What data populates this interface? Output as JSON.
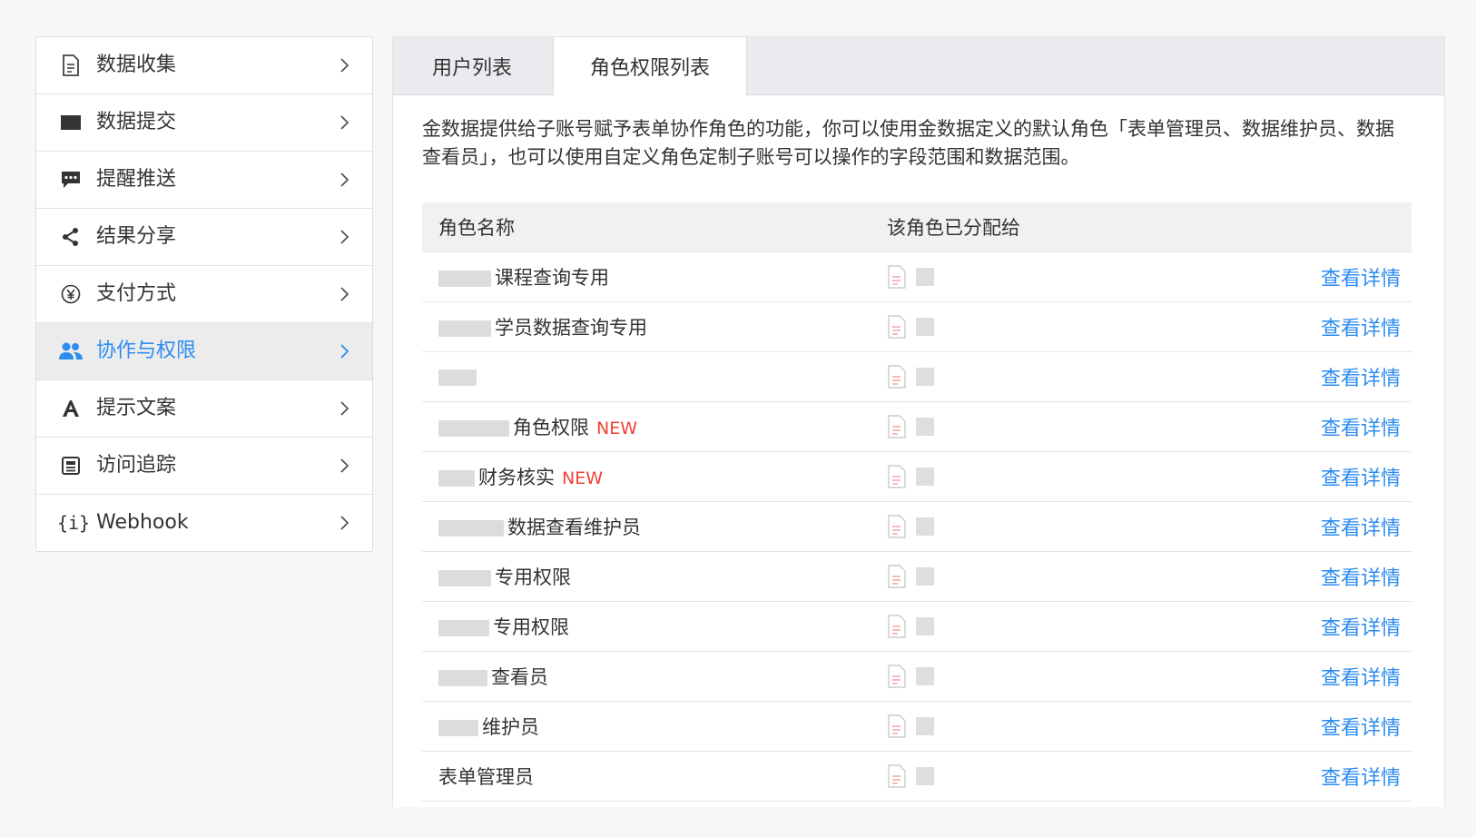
{
  "sidebar": {
    "items": [
      {
        "label": "数据收集",
        "icon": "document-icon"
      },
      {
        "label": "数据提交",
        "icon": "folder-icon"
      },
      {
        "label": "提醒推送",
        "icon": "chat-bubble-icon"
      },
      {
        "label": "结果分享",
        "icon": "share-icon"
      },
      {
        "label": "支付方式",
        "icon": "yen-circle-icon"
      },
      {
        "label": "协作与权限",
        "icon": "users-icon"
      },
      {
        "label": "提示文案",
        "icon": "font-a-icon"
      },
      {
        "label": "访问追踪",
        "icon": "tracking-icon"
      },
      {
        "label": "Webhook",
        "icon": "braces-i-icon"
      }
    ],
    "active_index": 5,
    "active_color": "#2d8cf0"
  },
  "tabs": [
    {
      "label": "用户列表"
    },
    {
      "label": "角色权限列表"
    }
  ],
  "active_tab": 1,
  "description": "金数据提供给子账号赋予表单协作角色的功能，你可以使用金数据定义的默认角色「表单管理员、数据维护员、数据查看员」，也可以使用自定义角色定制子账号可以操作的字段范围和数据范围。",
  "table": {
    "headers": {
      "name": "角色名称",
      "assigned": "该角色已分配给"
    },
    "link_label": "查看详情",
    "new_badge": "NEW",
    "rows": [
      {
        "name": "课程查询专用",
        "new": false
      },
      {
        "name": "学员数据查询专用",
        "new": false
      },
      {
        "name": "",
        "new": false
      },
      {
        "name": "角色权限",
        "new": true
      },
      {
        "name": "财务核实",
        "new": true
      },
      {
        "name": "数据查看维护员",
        "new": false
      },
      {
        "name": "专用权限",
        "new": false
      },
      {
        "name": "专用权限",
        "new": false
      },
      {
        "name": "查看员",
        "new": false
      },
      {
        "name": "维护员",
        "new": false
      },
      {
        "name": "表单管理员",
        "new": false
      }
    ]
  }
}
